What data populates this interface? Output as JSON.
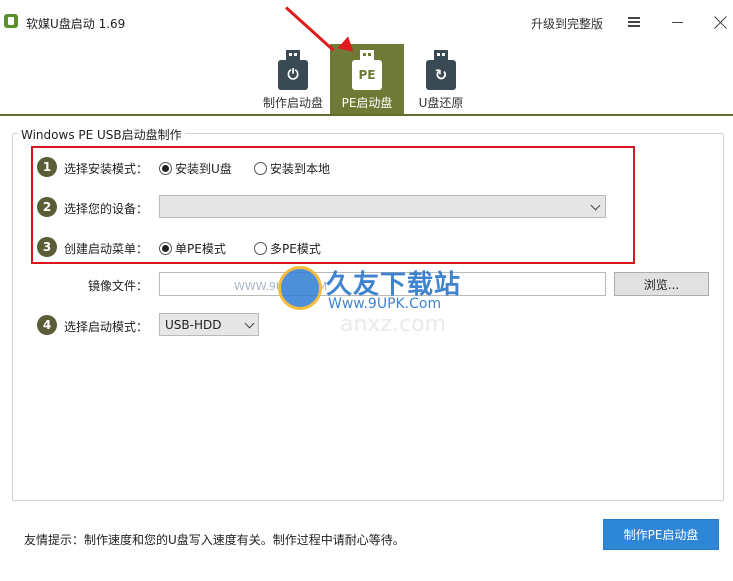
{
  "window": {
    "title": "软媒U盘启动 1.69",
    "upgrade_label": "升级到完整版"
  },
  "tabs": [
    {
      "label": "制作启动盘",
      "icon": "power-usb-icon",
      "active": false
    },
    {
      "label": "PE启动盘",
      "icon": "pe-usb-icon",
      "badge": "PE",
      "active": true
    },
    {
      "label": "U盘还原",
      "icon": "restore-usb-icon",
      "active": false
    }
  ],
  "group": {
    "title": "Windows PE USB启动盘制作"
  },
  "steps": {
    "s1": {
      "num": "1",
      "label": "选择安装模式：",
      "opt1": "安装到U盘",
      "opt2": "安装到本地"
    },
    "s2": {
      "num": "2",
      "label": "选择您的设备：",
      "value": ""
    },
    "s3": {
      "num": "3",
      "label": "创建启动菜单：",
      "opt1": "单PE模式",
      "opt2": "多PE模式"
    },
    "image": {
      "label": "镜像文件：",
      "value": "",
      "browse": "浏览..."
    },
    "s4": {
      "num": "4",
      "label": "选择启动模式：",
      "value": "USB-HDD"
    }
  },
  "watermark": {
    "cn": "久友下载站",
    "url": "Www.9UPK.Com",
    "small": "WWW.9UPK.COM",
    "bg": "anxz.com"
  },
  "footer": {
    "tip": "友情提示：制作速度和您的U盘写入速度有关。制作过程中请耐心等待。",
    "make_button": "制作PE启动盘"
  },
  "colors": {
    "accent_tab": "#6e7a35",
    "primary_button": "#2e86d6",
    "highlight_box": "#d9161c",
    "step_badge": "#5a5d36"
  }
}
